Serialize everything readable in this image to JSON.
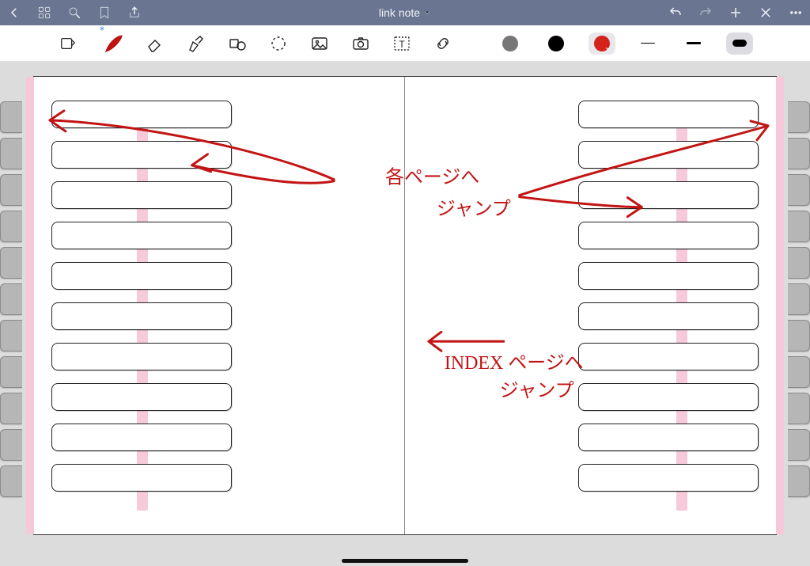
{
  "topbar": {
    "title": "link note"
  },
  "toolbar": {
    "colors": {
      "c1": "#777777",
      "c2": "#000000",
      "c3": "#d3231a"
    },
    "line_weights": {
      "w1": "1px",
      "w2": "3px",
      "w3": "10px"
    },
    "selected_color_index": 2,
    "selected_weight_index": 2
  },
  "notebook": {
    "left_page": {
      "slots": [
        "",
        "",
        "",
        "",
        "",
        "",
        "",
        "",
        "",
        ""
      ]
    },
    "right_page": {
      "slots": [
        "",
        "",
        "",
        "",
        "",
        "",
        "",
        "",
        "",
        ""
      ]
    },
    "side_tabs_count": 11
  },
  "annotations": {
    "jump_to_pages": "各ページへ",
    "jump_to_pages_sub": "ジャンプ",
    "jump_to_index": "INDEX ページへ",
    "jump_to_index_sub": "ジャンプ"
  }
}
